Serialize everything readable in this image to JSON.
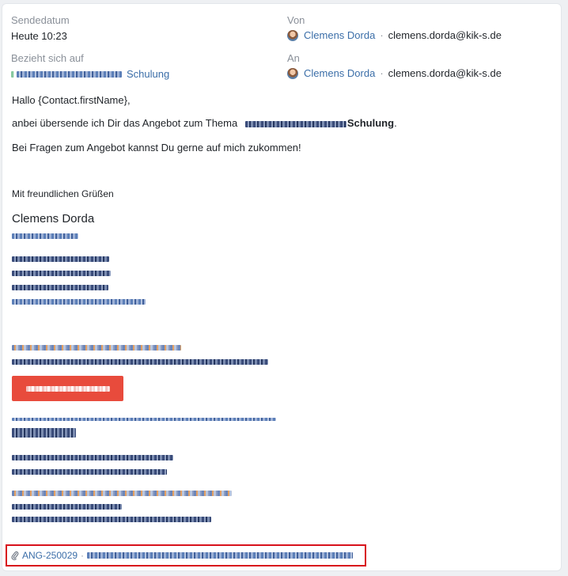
{
  "meta": {
    "sent_label": "Sendedatum",
    "sent_value": "Heute 10:23",
    "from_label": "Von",
    "from_name": "Clemens Dorda",
    "from_email": "clemens.dorda@kik-s.de",
    "related_label": "Bezieht sich auf",
    "related_link_visible": "Schulung",
    "to_label": "An",
    "to_name": "Clemens Dorda",
    "to_email": "clemens.dorda@kik-s.de",
    "separator": "·"
  },
  "message": {
    "greeting": "Hallo {Contact.firstName},",
    "line1_prefix": "anbei übersende ich Dir das Angebot zum Thema",
    "line1_suffix": "Schulung",
    "line1_end": ".",
    "line2": "Bei Fragen zum Angebot kannst Du gerne auf mich zukommen!",
    "closing": "Mit freundlichen Grüßen",
    "signature_name": "Clemens Dorda"
  },
  "attachment": {
    "code": "ANG-250029",
    "separator": "·"
  },
  "colors": {
    "link": "#3b6ea8",
    "cta": "#e84b3c",
    "highlight_border": "#d8111b"
  }
}
